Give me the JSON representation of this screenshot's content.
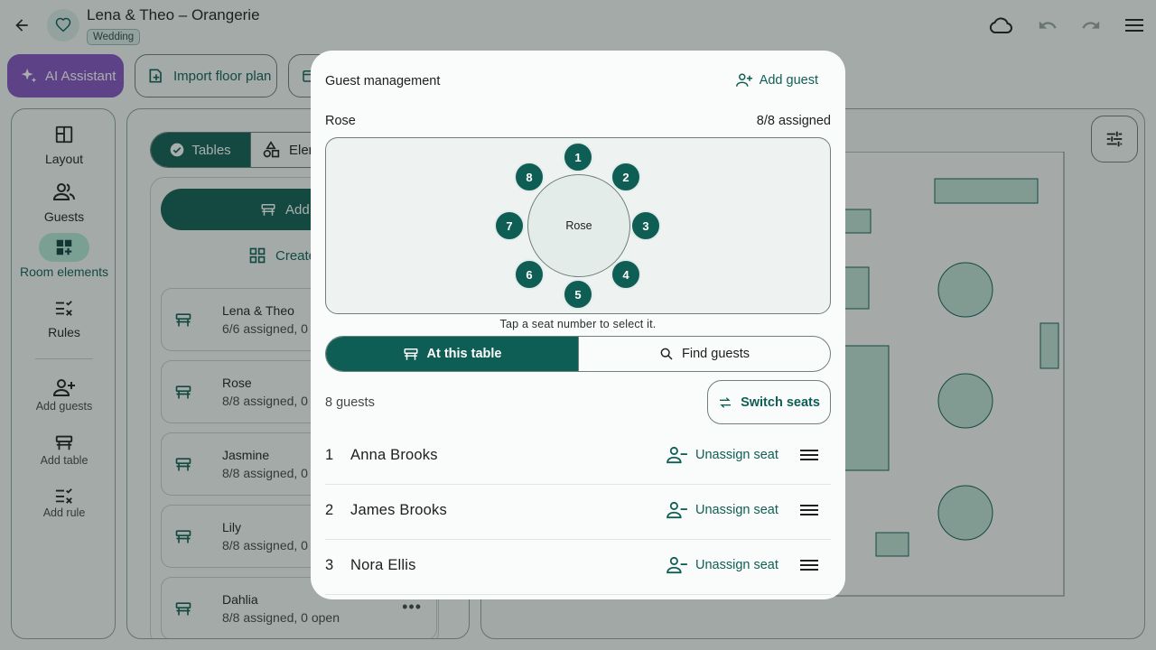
{
  "header": {
    "title": "Lena & Theo – Orangerie",
    "tag": "Wedding"
  },
  "toolbar": {
    "ai_label": "AI Assistant",
    "import_label": "Import floor plan"
  },
  "rail": {
    "items": [
      {
        "label": "Layout",
        "icon": "layout-icon"
      },
      {
        "label": "Guests",
        "icon": "guests-icon"
      },
      {
        "label": "Room elements",
        "icon": "room-elements-icon"
      },
      {
        "label": "Rules",
        "icon": "rules-icon"
      }
    ],
    "actions": [
      {
        "label": "Add guests",
        "icon": "add-guests-icon"
      },
      {
        "label": "Add table",
        "icon": "add-table-icon"
      },
      {
        "label": "Add rule",
        "icon": "add-rule-icon"
      }
    ]
  },
  "panel": {
    "tab_tables": "Tables",
    "tab_elements": "Elem",
    "add_table": "Add t",
    "create": "Create",
    "tables": [
      {
        "name": "Lena & Theo",
        "status": "6/6 assigned, 0"
      },
      {
        "name": "Rose",
        "status": "8/8 assigned, 0"
      },
      {
        "name": "Jasmine",
        "status": "8/8 assigned, 0"
      },
      {
        "name": "Lily",
        "status": "8/8 assigned, 0"
      },
      {
        "name": "Dahlia",
        "status": "8/8 assigned, 0 open"
      }
    ]
  },
  "modal": {
    "title": "Guest management",
    "add_guest": "Add guest",
    "table_name": "Rose",
    "assigned": "8/8 assigned",
    "table_label": "Rose",
    "seats": [
      "1",
      "2",
      "3",
      "4",
      "5",
      "6",
      "7",
      "8"
    ],
    "hint": "Tap a seat number to select it.",
    "toggle_at_table": "At this table",
    "toggle_find": "Find guests",
    "guest_count": "8 guests",
    "switch_seats": "Switch seats",
    "guests": [
      {
        "seat": "1",
        "name": "Anna Brooks",
        "action": "Unassign seat"
      },
      {
        "seat": "2",
        "name": "James Brooks",
        "action": "Unassign seat"
      },
      {
        "seat": "3",
        "name": "Nora Ellis",
        "action": "Unassign seat"
      }
    ]
  },
  "colors": {
    "primary": "#0f5e55",
    "ai": "#8553c6",
    "active_pill": "#b4ead9"
  }
}
